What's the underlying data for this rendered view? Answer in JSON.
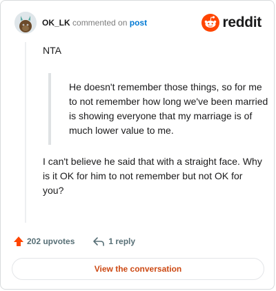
{
  "header": {
    "username": "OK_LK",
    "commented_on": "commented on",
    "post_link": "post",
    "brand": "reddit"
  },
  "comment": {
    "paragraph_1": "NTA",
    "quote": "He doesn't remember those things, so for me to not remember how long we've been married is showing everyone that my marriage is of much lower value to me.",
    "paragraph_2": "I can't believe he said that with a straight face. Why is it OK for him to not remember but not OK for you?"
  },
  "footer": {
    "upvotes": "202 upvotes",
    "replies": "1 reply"
  },
  "cta": {
    "label": "View the conversation"
  },
  "colors": {
    "brand_orange": "#ff4500",
    "link_blue": "#0079d3",
    "cta_text": "#cc4812",
    "muted": "#576f76"
  },
  "icons": [
    "avatar-icon",
    "reddit-logo-icon",
    "upvote-arrow-icon",
    "reply-arrow-icon"
  ]
}
